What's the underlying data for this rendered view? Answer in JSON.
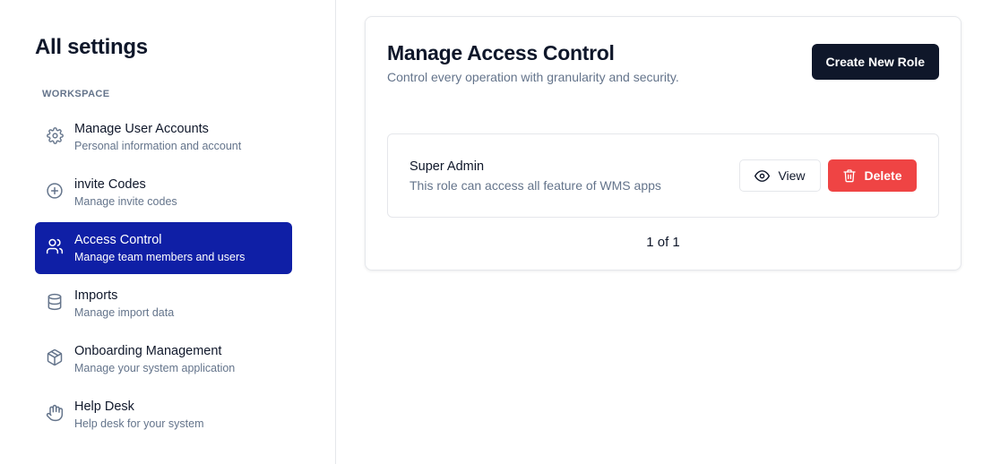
{
  "sidebar": {
    "title": "All settings",
    "section_label": "WORKSPACE",
    "items": [
      {
        "label": "Manage User Accounts",
        "sub": "Personal information and account",
        "icon": "gear-icon"
      },
      {
        "label": "invite Codes",
        "sub": "Manage invite codes",
        "icon": "plus-circle-icon"
      },
      {
        "label": "Access Control",
        "sub": "Manage team members and users",
        "icon": "users-icon",
        "active": true
      },
      {
        "label": "Imports",
        "sub": "Manage import data",
        "icon": "database-icon"
      },
      {
        "label": "Onboarding Management",
        "sub": "Manage your system application",
        "icon": "package-icon"
      },
      {
        "label": "Help Desk",
        "sub": "Help desk for your system",
        "icon": "hand-icon"
      }
    ]
  },
  "main": {
    "title": "Manage Access Control",
    "description": "Control every operation with granularity and security.",
    "create_button": "Create New Role",
    "roles": [
      {
        "name": "Super Admin",
        "description": "This role can access all feature of WMS apps"
      }
    ],
    "view_button": "View",
    "delete_button": "Delete",
    "pagination": "1 of 1"
  },
  "colors": {
    "active_nav": "#0f1fa6",
    "primary_button": "#0f172a",
    "danger": "#ef4444",
    "muted_text": "#64748b"
  }
}
